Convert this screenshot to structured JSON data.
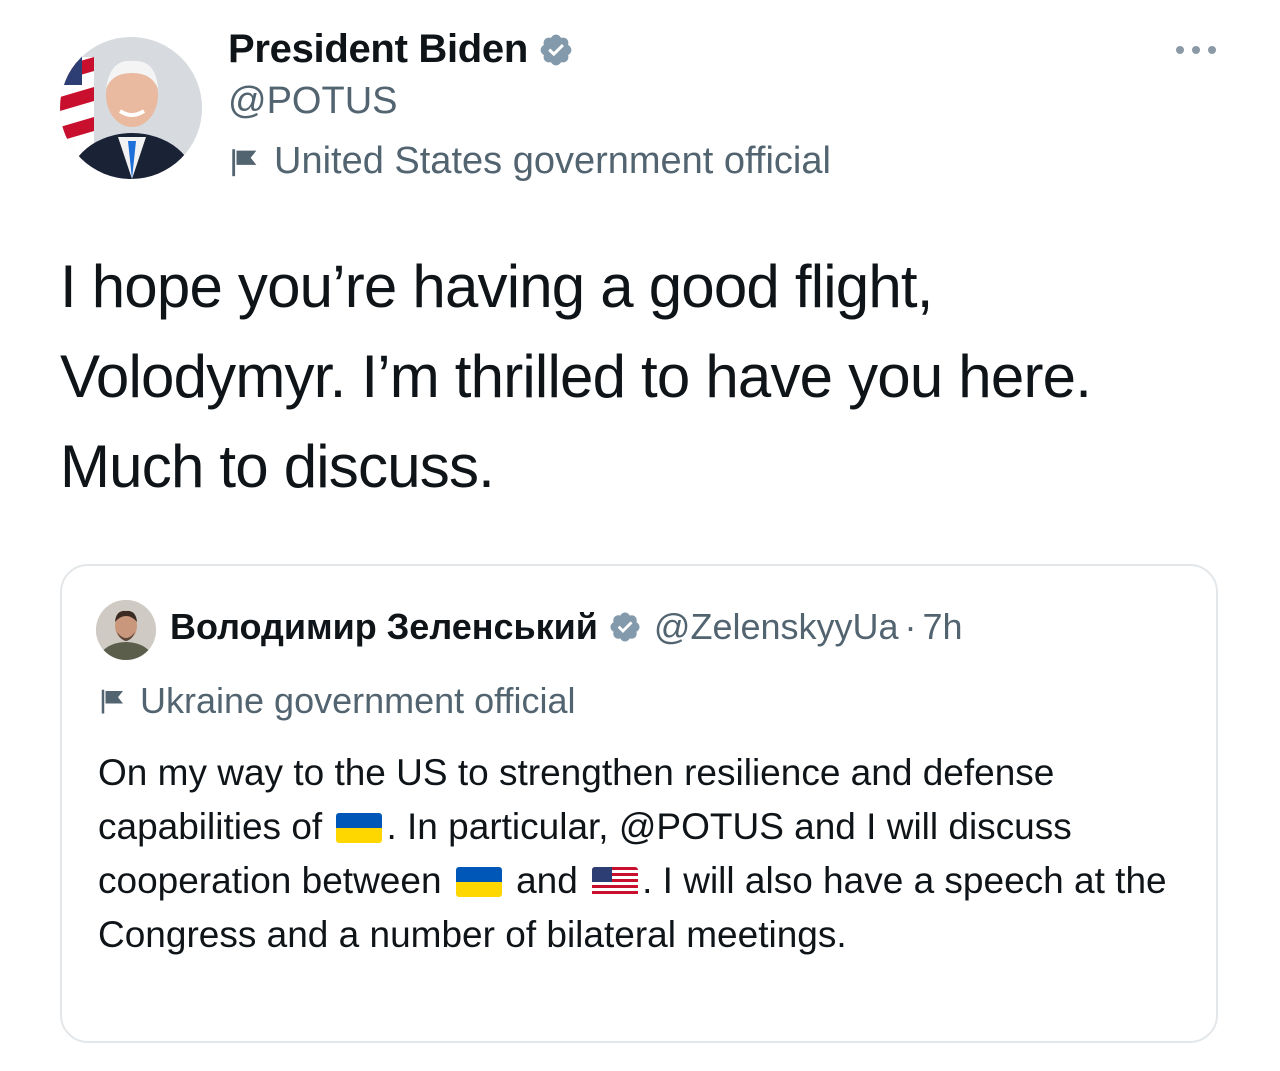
{
  "author": {
    "name": "President Biden",
    "handle": "@POTUS",
    "label": "United States government official",
    "verified": true
  },
  "tweet": {
    "text": "I hope you’re having a good flight, Volodymyr. I’m thrilled to have you here. Much to discuss."
  },
  "quoted": {
    "name": "Володимир Зеленський",
    "handle": "@ZelenskyyUa",
    "separator": "·",
    "time": "7h",
    "label": "Ukraine government official",
    "verified": true,
    "text_parts": {
      "p1": "On my way to the US to strengthen resilience and defense capabilities of",
      "p2": ". In particular, @POTUS and I will discuss cooperation between",
      "p3": "and",
      "p4": ". I will also have a speech at the Congress and a number of bilateral meetings."
    },
    "emoji": {
      "flag1": "flag-ukraine-icon",
      "flag2": "flag-ukraine-icon",
      "flag3": "flag-united-states-icon"
    }
  },
  "icons": {
    "verified": "verified-badge-icon",
    "gov_label": "government-flag-icon",
    "more": "more-horizontal-icon"
  },
  "colors": {
    "text": "#0f1419",
    "secondary": "#536471",
    "border": "#e3e7ea",
    "verified": "#829aab",
    "ukraine_blue": "#0057b7",
    "ukraine_yellow": "#ffd700"
  }
}
